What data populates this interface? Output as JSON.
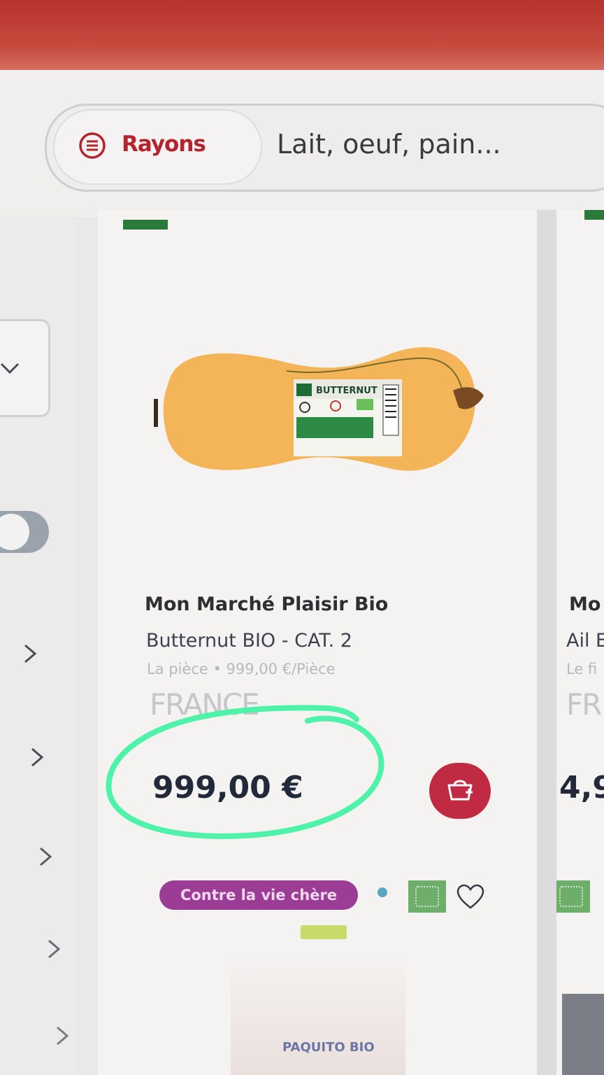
{
  "header": {
    "rayons_label": "Rayons",
    "search_placeholder": "Lait, oeuf, pain..."
  },
  "product": {
    "brand": "Mon Marché Plaisir Bio",
    "name": "Butternut BIO - CAT. 2",
    "unit_price": "La pièce • 999,00 €/Pièce",
    "origin": "FRANCE",
    "price": "999,00 €",
    "badge": "Contre la vie chère",
    "label_text": "BUTTERNUT"
  },
  "next_product": {
    "brand": "Mo",
    "name": "Ail E",
    "unit_price": "Le fi",
    "origin": "FR",
    "price": "4,9"
  },
  "bottom_product": {
    "logo_text": "PAQUITO BIO"
  },
  "colors": {
    "brand_red": "#b3242c",
    "cart_button": "#c02a43",
    "badge_purple": "#9b3d95",
    "annotation_green": "#4ef2a8"
  },
  "icons": [
    "menu-circle-icon",
    "chevron-down-icon",
    "chevron-right-icon",
    "add-to-cart-icon",
    "heart-icon",
    "eu-organic-logo"
  ]
}
